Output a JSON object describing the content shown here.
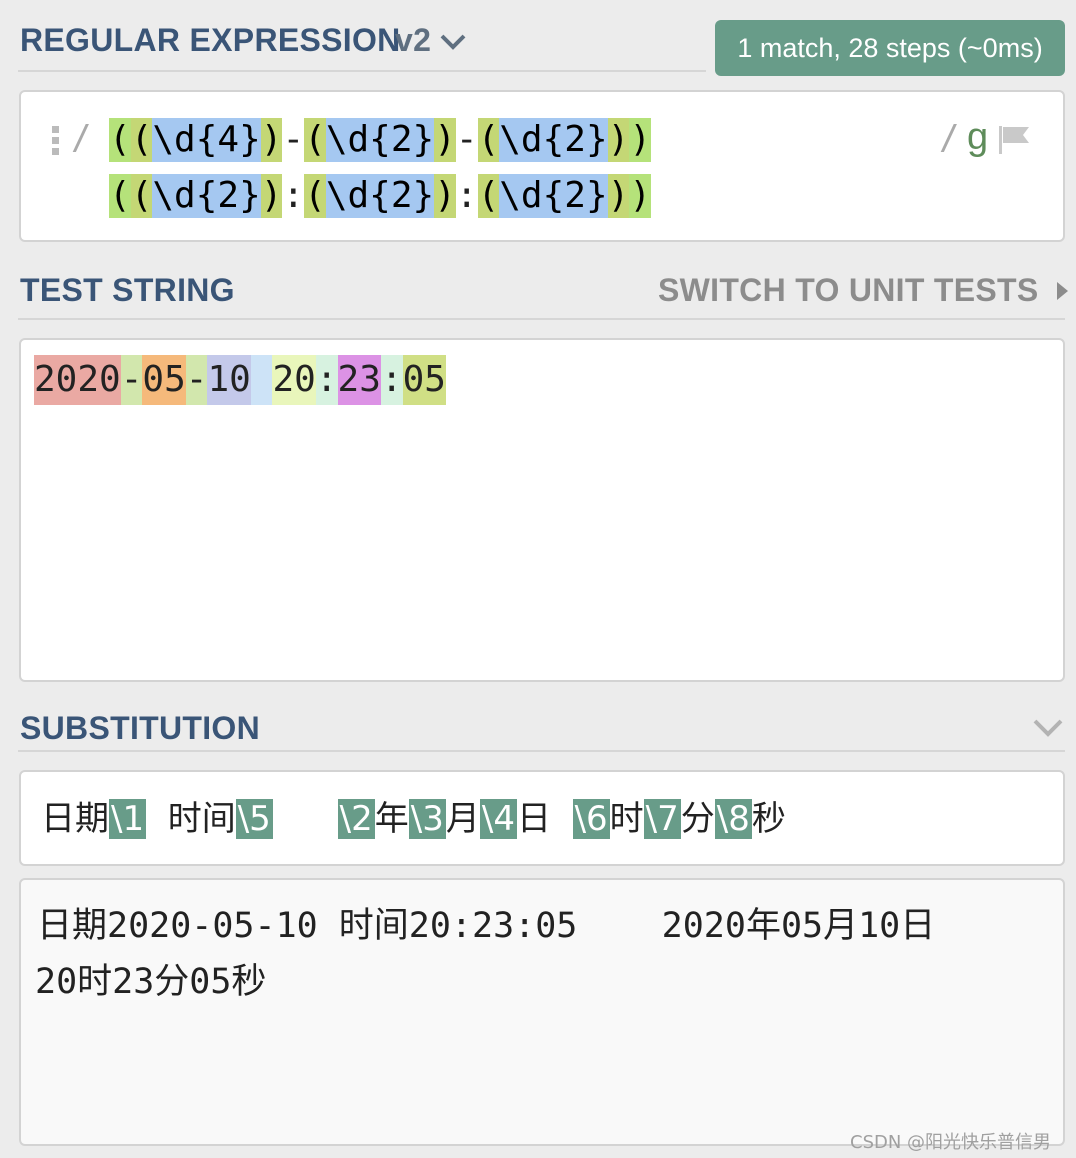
{
  "regex": {
    "heading": "REGULAR EXPRESSION",
    "version": "v2",
    "match_badge": "1 match, 28 steps (~0ms)",
    "delimiter_open": "/",
    "delimiter_close": "/",
    "flags": "g",
    "line1": [
      {
        "t": "(",
        "c": "g1"
      },
      {
        "t": "(",
        "c": "g2"
      },
      {
        "t": "\\d{4}",
        "c": "g3"
      },
      {
        "t": ")",
        "c": "g2"
      },
      {
        "t": "-",
        "c": ""
      },
      {
        "t": "(",
        "c": "g2"
      },
      {
        "t": "\\d{2}",
        "c": "g3"
      },
      {
        "t": ")",
        "c": "g2"
      },
      {
        "t": "-",
        "c": ""
      },
      {
        "t": "(",
        "c": "g2"
      },
      {
        "t": "\\d{2}",
        "c": "g3"
      },
      {
        "t": ")",
        "c": "g2"
      },
      {
        "t": ")",
        "c": "g1"
      }
    ],
    "line2": [
      {
        "t": "(",
        "c": "g1"
      },
      {
        "t": "(",
        "c": "g2"
      },
      {
        "t": "\\d{2}",
        "c": "g3"
      },
      {
        "t": ")",
        "c": "g2"
      },
      {
        "t": ":",
        "c": ""
      },
      {
        "t": "(",
        "c": "g2"
      },
      {
        "t": "\\d{2}",
        "c": "g3"
      },
      {
        "t": ")",
        "c": "g2"
      },
      {
        "t": ":",
        "c": ""
      },
      {
        "t": "(",
        "c": "g2"
      },
      {
        "t": "\\d{2}",
        "c": "g3"
      },
      {
        "t": ")",
        "c": "g2"
      },
      {
        "t": ")",
        "c": "g1"
      }
    ]
  },
  "test": {
    "heading": "TEST STRING",
    "switch_label": "SWITCH TO UNIT TESTS",
    "segments": [
      {
        "t": "2020",
        "bg": "#eaa9a3"
      },
      {
        "t": "-",
        "bg": "#d2e7ad"
      },
      {
        "t": "05",
        "bg": "#f5b97b"
      },
      {
        "t": "-",
        "bg": "#d2e7ad"
      },
      {
        "t": "10",
        "bg": "#c4c9ea"
      },
      {
        "t": " ",
        "bg": "#cde3f7"
      },
      {
        "t": "20",
        "bg": "#e9f6bb"
      },
      {
        "t": ":",
        "bg": "#d7f2e0"
      },
      {
        "t": "23",
        "bg": "#dc92e5"
      },
      {
        "t": ":",
        "bg": "#d7f2e0"
      },
      {
        "t": "05",
        "bg": "#d0df85"
      }
    ]
  },
  "substitution": {
    "heading": "SUBSTITUTION",
    "tokens": [
      {
        "t": "日期",
        "ref": false
      },
      {
        "t": "\\1",
        "ref": true
      },
      {
        "t": "  时间",
        "ref": false
      },
      {
        "t": "\\5",
        "ref": true
      },
      {
        "t": "      ",
        "ref": false
      },
      {
        "t": "\\2",
        "ref": true
      },
      {
        "t": "年",
        "ref": false
      },
      {
        "t": "\\3",
        "ref": true
      },
      {
        "t": "月",
        "ref": false
      },
      {
        "t": "\\4",
        "ref": true
      },
      {
        "t": "日  ",
        "ref": false
      },
      {
        "t": "\\6",
        "ref": true
      },
      {
        "t": "时",
        "ref": false
      },
      {
        "t": "\\7",
        "ref": true
      },
      {
        "t": "分",
        "ref": false
      },
      {
        "t": "\\8",
        "ref": true
      },
      {
        "t": "秒",
        "ref": false
      }
    ],
    "result_line1": "日期2020-05-10 时间20:23:05    2020年05月10日",
    "result_line2": "20时23分05秒"
  },
  "watermark": "CSDN @阳光快乐普信男"
}
